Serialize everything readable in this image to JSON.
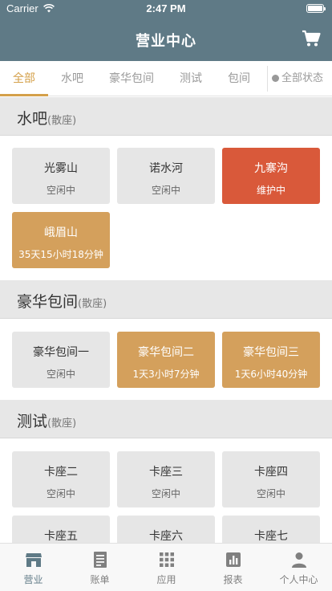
{
  "status_bar": {
    "carrier": "Carrier",
    "time": "2:47 PM"
  },
  "header": {
    "title": "营业中心",
    "cart_icon": "cart-icon"
  },
  "tabs": [
    {
      "label": "全部",
      "active": true
    },
    {
      "label": "水吧",
      "active": false
    },
    {
      "label": "豪华包间",
      "active": false
    },
    {
      "label": "测试",
      "active": false
    },
    {
      "label": "包间",
      "active": false
    }
  ],
  "status_filter": {
    "label": "全部状态"
  },
  "colors": {
    "header": "#5f7a86",
    "accent": "#d4a04a",
    "busy": "#d4a05c",
    "maintenance": "#d9593a",
    "idle": "#e6e6e6"
  },
  "sections": [
    {
      "name": "水吧",
      "sub": "(散座)",
      "tables": [
        {
          "name": "光雾山",
          "state": "空闲中",
          "status": "idle"
        },
        {
          "name": "诺水河",
          "state": "空闲中",
          "status": "idle"
        },
        {
          "name": "九寨沟",
          "state": "维护中",
          "status": "maintenance"
        },
        {
          "name": "峨眉山",
          "state": "35天15小时18分钟",
          "status": "busy"
        }
      ]
    },
    {
      "name": "豪华包间",
      "sub": "(散座)",
      "tables": [
        {
          "name": "豪华包间一",
          "state": "空闲中",
          "status": "idle"
        },
        {
          "name": "豪华包间二",
          "state": "1天3小时7分钟",
          "status": "busy"
        },
        {
          "name": "豪华包间三",
          "state": "1天6小时40分钟",
          "status": "busy"
        }
      ]
    },
    {
      "name": "测试",
      "sub": "(散座)",
      "tables": [
        {
          "name": "卡座二",
          "state": "空闲中",
          "status": "idle"
        },
        {
          "name": "卡座三",
          "state": "空闲中",
          "status": "idle"
        },
        {
          "name": "卡座四",
          "state": "空闲中",
          "status": "idle"
        },
        {
          "name": "卡座五",
          "state": "",
          "status": "idle"
        },
        {
          "name": "卡座六",
          "state": "",
          "status": "idle"
        },
        {
          "name": "卡座七",
          "state": "",
          "status": "idle"
        }
      ]
    }
  ],
  "tabbar": [
    {
      "label": "营业",
      "icon": "store-icon",
      "active": true
    },
    {
      "label": "账单",
      "icon": "bill-icon",
      "active": false
    },
    {
      "label": "应用",
      "icon": "apps-grid-icon",
      "active": false
    },
    {
      "label": "报表",
      "icon": "report-chart-icon",
      "active": false
    },
    {
      "label": "个人中心",
      "icon": "person-icon",
      "active": false
    }
  ]
}
